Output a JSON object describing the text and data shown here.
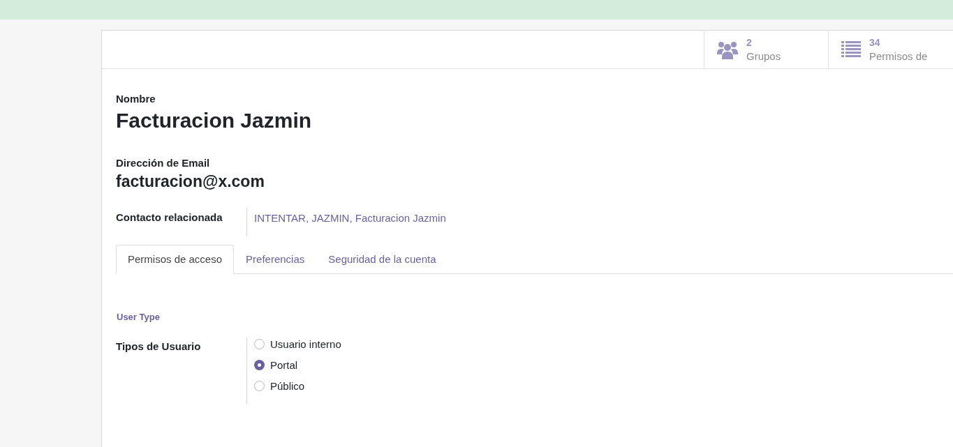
{
  "stat_buttons": [
    {
      "kind": "groups",
      "count": "2",
      "label": "Grupos"
    },
    {
      "kind": "list",
      "count": "34",
      "label": "Permisos de"
    }
  ],
  "name": {
    "label": "Nombre",
    "value": "Facturacion Jazmin"
  },
  "email": {
    "label": "Dirección de Email",
    "value": "facturacion@x.com"
  },
  "related_contact": {
    "label": "Contacto relacionada",
    "value": "INTENTAR, JAZMIN, Facturacion Jazmin"
  },
  "tabs": [
    {
      "label": "Permisos de acceso",
      "selected": true
    },
    {
      "label": "Preferencias",
      "selected": false
    },
    {
      "label": "Seguridad de la cuenta",
      "selected": false
    }
  ],
  "section_title": "User Type",
  "user_type": {
    "label": "Tipos de Usuario",
    "options": [
      {
        "label": "Usuario interno",
        "selected": false
      },
      {
        "label": "Portal",
        "selected": true
      },
      {
        "label": "Público",
        "selected": false
      }
    ]
  }
}
